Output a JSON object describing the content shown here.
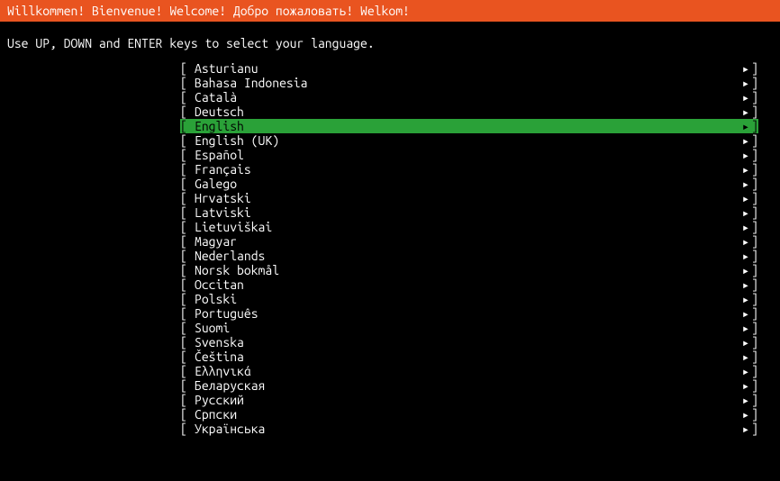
{
  "header": {
    "title": "Willkommen! Bienvenue! Welcome! Добро пожаловать! Welkom!"
  },
  "instruction": "Use UP, DOWN and ENTER keys to select your language.",
  "languages": [
    {
      "name": "Asturianu",
      "selected": false
    },
    {
      "name": "Bahasa Indonesia",
      "selected": false
    },
    {
      "name": "Català",
      "selected": false
    },
    {
      "name": "Deutsch",
      "selected": false
    },
    {
      "name": "English",
      "selected": true
    },
    {
      "name": "English (UK)",
      "selected": false
    },
    {
      "name": "Español",
      "selected": false
    },
    {
      "name": "Français",
      "selected": false
    },
    {
      "name": "Galego",
      "selected": false
    },
    {
      "name": "Hrvatski",
      "selected": false
    },
    {
      "name": "Latviski",
      "selected": false
    },
    {
      "name": "Lietuviškai",
      "selected": false
    },
    {
      "name": "Magyar",
      "selected": false
    },
    {
      "name": "Nederlands",
      "selected": false
    },
    {
      "name": "Norsk bokmål",
      "selected": false
    },
    {
      "name": "Occitan",
      "selected": false
    },
    {
      "name": "Polski",
      "selected": false
    },
    {
      "name": "Português",
      "selected": false
    },
    {
      "name": "Suomi",
      "selected": false
    },
    {
      "name": "Svenska",
      "selected": false
    },
    {
      "name": "Čeština",
      "selected": false
    },
    {
      "name": "Ελληνικά",
      "selected": false
    },
    {
      "name": "Беларуская",
      "selected": false
    },
    {
      "name": "Русский",
      "selected": false
    },
    {
      "name": "Српски",
      "selected": false
    },
    {
      "name": "Українська",
      "selected": false
    }
  ],
  "glyphs": {
    "bracket_open": "[",
    "bracket_close": "]",
    "arrow": "▸"
  }
}
